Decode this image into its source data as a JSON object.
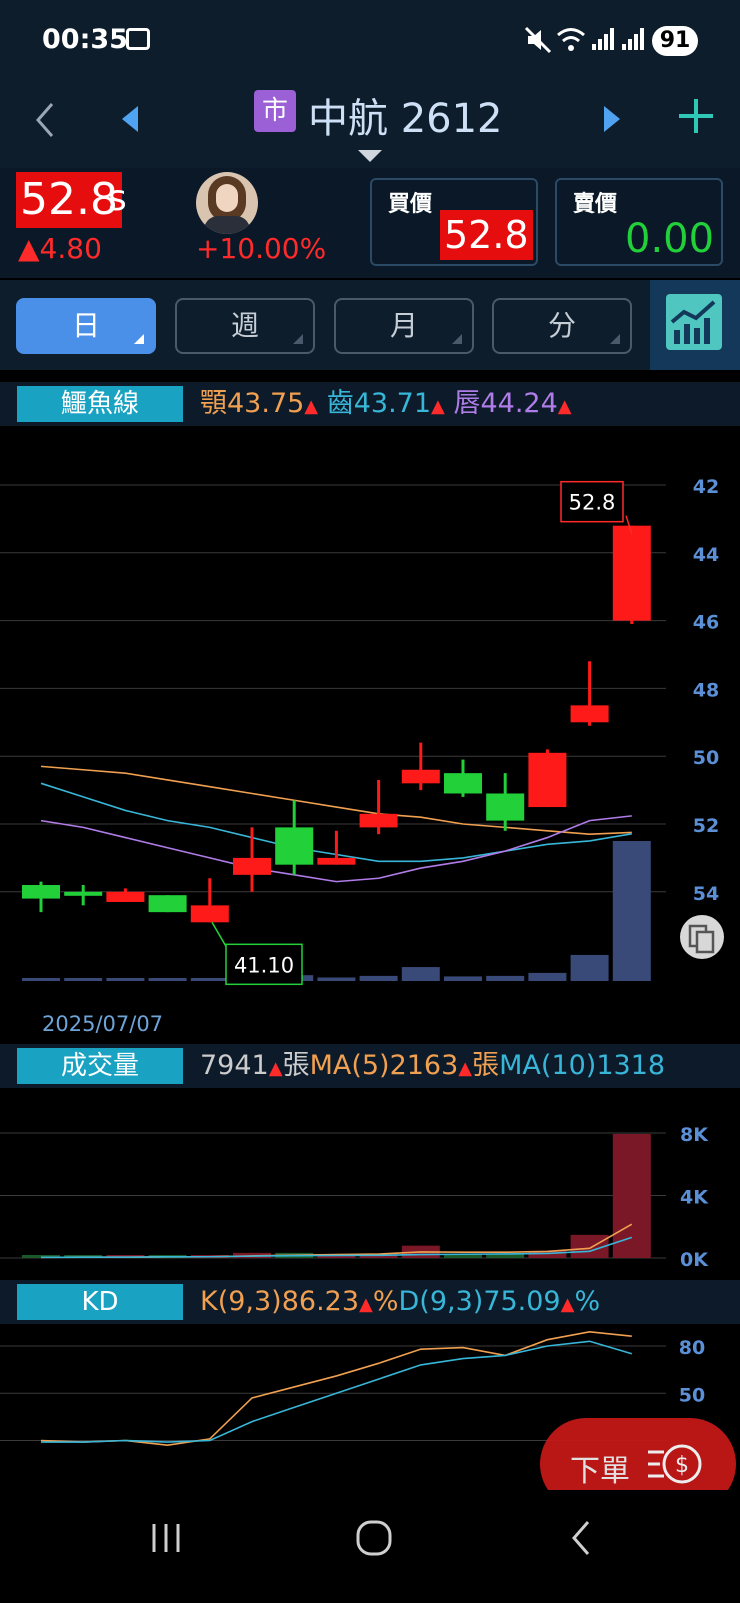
{
  "status": {
    "time": "00:35",
    "battery": "91"
  },
  "header": {
    "market_badge": "市",
    "stock": "中航 2612"
  },
  "quote": {
    "price": "52.8",
    "price_suffix": "s",
    "change": "▲4.80",
    "change_pct": "+10.00%",
    "bid_label": "買價",
    "bid": "52.8",
    "ask_label": "賣價",
    "ask": "0.00"
  },
  "tabs": {
    "day": "日",
    "week": "週",
    "month": "月",
    "minute": "分"
  },
  "alligator": {
    "label": "鱷魚線",
    "jaw_label": "顎",
    "jaw": "43.75",
    "teeth_label": "齒",
    "teeth": "43.71",
    "lips_label": "唇",
    "lips": "44.24",
    "arrow": "▲"
  },
  "price_chart": {
    "y_ticks": [
      "54",
      "52",
      "50",
      "48",
      "46",
      "44",
      "42"
    ],
    "high_label": "52.8",
    "low_label": "41.10",
    "date_label": "2025/07/07"
  },
  "volume": {
    "label": "成交量",
    "value": "7941",
    "unit": "張",
    "ma5_label": "MA(5)",
    "ma5": "2163",
    "ma10_label": "MA(10)",
    "ma10": "1318",
    "arrow": "▲",
    "y_ticks": [
      "8K",
      "4K",
      "0K"
    ]
  },
  "kd": {
    "label": "KD",
    "k_label": "K(9,3)",
    "k": "86.23",
    "d_label": "D(9,3)",
    "d": "75.09",
    "pct": "%",
    "arrow": "▲",
    "y_ticks": [
      "80",
      "50"
    ]
  },
  "order_button": {
    "label": "下單"
  },
  "colors": {
    "up": "#ff1a1a",
    "down": "#22d13a",
    "jaw": "#f0a050",
    "teeth": "#38b6d8",
    "lips": "#b07ce8",
    "volume_bar": "#3a4a78",
    "header_bg": "#0e1d2c",
    "tag": "#1aa2c2"
  },
  "chart_data": [
    {
      "type": "candlestick",
      "ylim": [
        40.5,
        55
      ],
      "y_ticks": [
        42,
        44,
        46,
        48,
        50,
        52,
        54
      ],
      "candles": [
        {
          "o": 42.2,
          "h": 42.3,
          "l": 41.4,
          "c": 41.8,
          "dir": "down"
        },
        {
          "o": 42.0,
          "h": 42.2,
          "l": 41.6,
          "c": 41.9,
          "dir": "down"
        },
        {
          "o": 41.7,
          "h": 42.1,
          "l": 41.7,
          "c": 42.0,
          "dir": "up"
        },
        {
          "o": 41.9,
          "h": 41.9,
          "l": 41.4,
          "c": 41.4,
          "dir": "down"
        },
        {
          "o": 41.1,
          "h": 42.4,
          "l": 41.1,
          "c": 41.6,
          "dir": "up"
        },
        {
          "o": 42.5,
          "h": 43.9,
          "l": 42.0,
          "c": 43.0,
          "dir": "up"
        },
        {
          "o": 43.9,
          "h": 44.7,
          "l": 42.5,
          "c": 42.8,
          "dir": "down"
        },
        {
          "o": 42.8,
          "h": 43.8,
          "l": 42.8,
          "c": 43.0,
          "dir": "up"
        },
        {
          "o": 43.9,
          "h": 45.3,
          "l": 43.7,
          "c": 44.3,
          "dir": "up"
        },
        {
          "o": 45.6,
          "h": 46.4,
          "l": 45.0,
          "c": 45.2,
          "dir": "up"
        },
        {
          "o": 45.5,
          "h": 45.9,
          "l": 44.8,
          "c": 44.9,
          "dir": "down"
        },
        {
          "o": 44.9,
          "h": 45.5,
          "l": 43.8,
          "c": 44.1,
          "dir": "down"
        },
        {
          "o": 44.5,
          "h": 46.2,
          "l": 44.5,
          "c": 46.1,
          "dir": "up"
        },
        {
          "o": 47.0,
          "h": 48.8,
          "l": 46.9,
          "c": 47.5,
          "dir": "up"
        },
        {
          "o": 50.0,
          "h": 52.8,
          "l": 49.9,
          "c": 52.8,
          "dir": "up"
        }
      ],
      "series": [
        {
          "name": "顎",
          "values": [
            45.7,
            45.6,
            45.5,
            45.3,
            45.1,
            44.9,
            44.7,
            44.5,
            44.3,
            44.2,
            44.0,
            43.9,
            43.8,
            43.7,
            43.75
          ]
        },
        {
          "name": "齒",
          "values": [
            45.2,
            44.8,
            44.4,
            44.1,
            43.9,
            43.6,
            43.3,
            43.1,
            42.9,
            42.9,
            43.0,
            43.2,
            43.4,
            43.5,
            43.71
          ]
        },
        {
          "name": "唇",
          "values": [
            44.1,
            43.9,
            43.6,
            43.3,
            43.0,
            42.7,
            42.5,
            42.3,
            42.4,
            42.7,
            42.9,
            43.2,
            43.6,
            44.1,
            44.24
          ]
        }
      ],
      "volume_bars": [
        40,
        60,
        50,
        140,
        100,
        330,
        330,
        200,
        290,
        790,
        260,
        290,
        460,
        1480,
        7941
      ]
    },
    {
      "type": "bar",
      "ylim": [
        0,
        10000
      ],
      "y_ticks": [
        0,
        4000,
        8000
      ],
      "values": [
        40,
        60,
        50,
        140,
        100,
        330,
        330,
        200,
        290,
        790,
        260,
        290,
        460,
        1480,
        7941
      ],
      "series": [
        {
          "name": "MA(5)",
          "values": [
            40,
            50,
            50,
            75,
            80,
            135,
            180,
            220,
            250,
            390,
            370,
            370,
            420,
            620,
            2163
          ]
        },
        {
          "name": "MA(10)",
          "values": [
            40,
            50,
            50,
            75,
            80,
            120,
            150,
            160,
            170,
            220,
            240,
            260,
            290,
            430,
            1318
          ]
        }
      ]
    },
    {
      "type": "line",
      "ylim": [
        0,
        100
      ],
      "y_ticks": [
        50,
        80
      ],
      "series": [
        {
          "name": "K(9,3)",
          "values": [
            20,
            19,
            20,
            17,
            21,
            47,
            54,
            61,
            69,
            78,
            79,
            74,
            84,
            89,
            86.23
          ]
        },
        {
          "name": "D(9,3)",
          "values": [
            19,
            19,
            20,
            19,
            20,
            32,
            41,
            50,
            59,
            68,
            72,
            74,
            80,
            83,
            75.09
          ]
        }
      ]
    }
  ]
}
